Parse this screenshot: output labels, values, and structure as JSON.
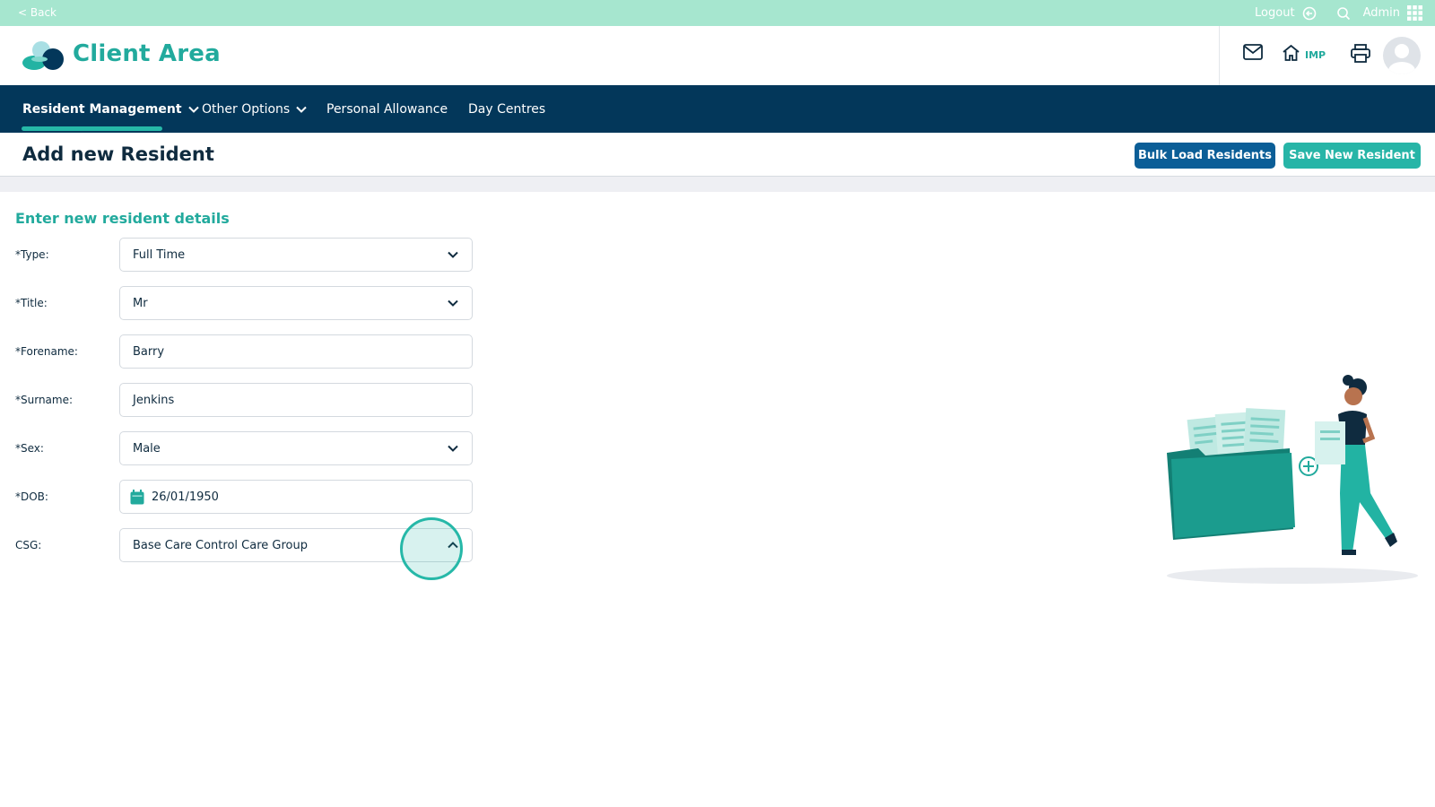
{
  "topbar": {
    "back_label": "< Back",
    "logout_label": "Logout",
    "user_label": "Admin"
  },
  "header": {
    "brand": "Client Area",
    "home_badge": "IMP"
  },
  "nav": {
    "items": [
      {
        "label": "Resident Management",
        "has_dropdown": true,
        "active": true
      },
      {
        "label": "Other Options",
        "has_dropdown": true,
        "active": false
      },
      {
        "label": "Personal Allowance",
        "has_dropdown": false,
        "active": false
      },
      {
        "label": "Day Centres",
        "has_dropdown": false,
        "active": false
      }
    ]
  },
  "page": {
    "title": "Add new Resident",
    "bulk_button": "Bulk Load Residents",
    "save_button": "Save New Resident"
  },
  "form": {
    "section_title": "Enter new resident details",
    "fields": [
      {
        "label": "*Type:",
        "value": "Full Time",
        "kind": "select"
      },
      {
        "label": "*Title:",
        "value": "Mr",
        "kind": "select"
      },
      {
        "label": "*Forename:",
        "value": "Barry",
        "kind": "text"
      },
      {
        "label": "*Surname:",
        "value": "Jenkins",
        "kind": "text"
      },
      {
        "label": "*Sex:",
        "value": "Male",
        "kind": "select"
      },
      {
        "label": "*DOB:",
        "value": "26/01/1950",
        "kind": "date"
      },
      {
        "label": "CSG:",
        "value": "Base Care Control Care Group",
        "kind": "select-open"
      }
    ]
  },
  "colors": {
    "accent": "#22aa9d",
    "nav_bg": "#03375a",
    "topbar_bg": "#a6e6cf",
    "bulk_button": "#0b5e97",
    "save_button": "#27b5a7"
  },
  "icons": {
    "logout": "logout-icon",
    "search": "search-icon",
    "apps": "apps-grid-icon",
    "mail": "mail-icon",
    "home": "home-icon",
    "print": "printer-icon",
    "calendar": "calendar-icon"
  }
}
